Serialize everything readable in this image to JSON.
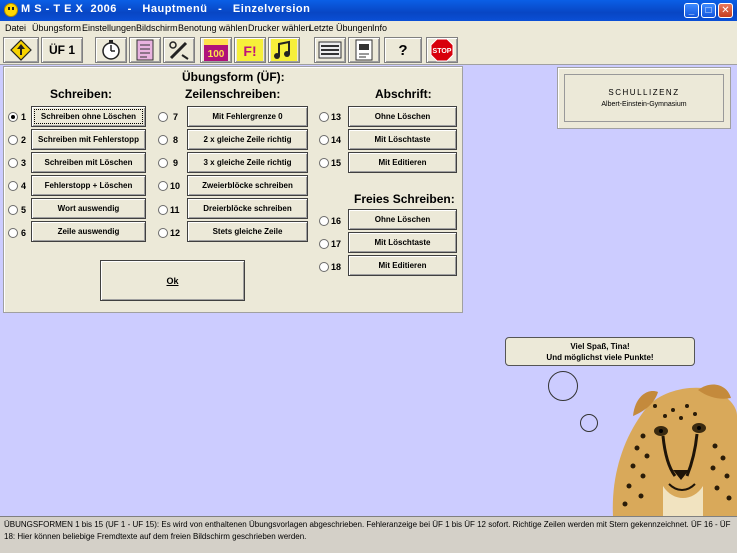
{
  "window": {
    "title": "M S - T E X  2006   -   Hauptmenü   -   Einzelversion",
    "minimize_glyph": "_",
    "maximize_glyph": "□",
    "close_glyph": "✕"
  },
  "menu": [
    "Datei",
    "Übungsform",
    "Einstellungen",
    "Bildschirm",
    "Benotung wählen",
    "Drucker wählen",
    "Letzte Übungen",
    "Info"
  ],
  "toolbar": {
    "uf_label": "ÜF 1",
    "hundred_label": "100",
    "help_label": "?",
    "stop_label": "STOP",
    "fa_label": "F!",
    "icons": [
      "up-arrow-sign-icon",
      "uf1-button",
      "stopwatch-icon",
      "checklist-icon",
      "pen-tool-icon",
      "score-100-icon",
      "fail-alert-icon",
      "music-icon",
      "keyboard-display-icon",
      "page-icon",
      "help-icon",
      "stop-sign-icon"
    ]
  },
  "panel": {
    "title": "Übungsform (ÜF):",
    "col1_heading": "Schreiben:",
    "col2_heading": "Zeilenschreiben:",
    "col3_heading": "Abschrift:",
    "col4_heading": "Freies Schreiben:",
    "options": [
      {
        "n": "1",
        "label": "Schreiben ohne Löschen"
      },
      {
        "n": "2",
        "label": "Schreiben mit Fehlerstopp"
      },
      {
        "n": "3",
        "label": "Schreiben mit Löschen"
      },
      {
        "n": "4",
        "label": "Fehlerstopp + Löschen"
      },
      {
        "n": "5",
        "label": "Wort auswendig"
      },
      {
        "n": "6",
        "label": "Zeile auswendig"
      },
      {
        "n": "7",
        "label": "Mit Fehlergrenze 0"
      },
      {
        "n": "8",
        "label": "2 x gleiche Zeile richtig"
      },
      {
        "n": "9",
        "label": "3 x gleiche Zeile richtig"
      },
      {
        "n": "10",
        "label": "Zweierblöcke schreiben"
      },
      {
        "n": "11",
        "label": "Dreierblöcke schreiben"
      },
      {
        "n": "12",
        "label": "Stets gleiche Zeile"
      },
      {
        "n": "13",
        "label": "Ohne Löschen"
      },
      {
        "n": "14",
        "label": "Mit Löschtaste"
      },
      {
        "n": "15",
        "label": "Mit Editieren"
      },
      {
        "n": "16",
        "label": "Ohne Löschen"
      },
      {
        "n": "17",
        "label": "Mit Löschtaste"
      },
      {
        "n": "18",
        "label": "Mit Editieren"
      }
    ],
    "selected": "1",
    "ok_label": "Ok"
  },
  "license": {
    "title": "SCHULLIZENZ",
    "school": "Albert-Einstein-Gymnasium"
  },
  "bubble": {
    "line1": "Viel Spaß, Tina!",
    "line2": "Und möglichst viele Punkte!"
  },
  "status_text": "ÜBUNGSFORMEN 1 bis 15 (UF 1 - UF 15): Es wird von enthaltenen Übungsvorlagen abgeschrieben. Fehleranzeige bei ÜF 1 bis ÜF 12 sofort. Richtige Zeilen werden mit Stern gekennzeichnet. ÜF 16 - ÜF 18: Hier können beliebige Fremdtexte auf dem freien Bildschirm geschrieben werden.",
  "colors": {
    "background": "#ccccff",
    "panel": "#ece9d8",
    "titlebar": "#0846c4"
  }
}
